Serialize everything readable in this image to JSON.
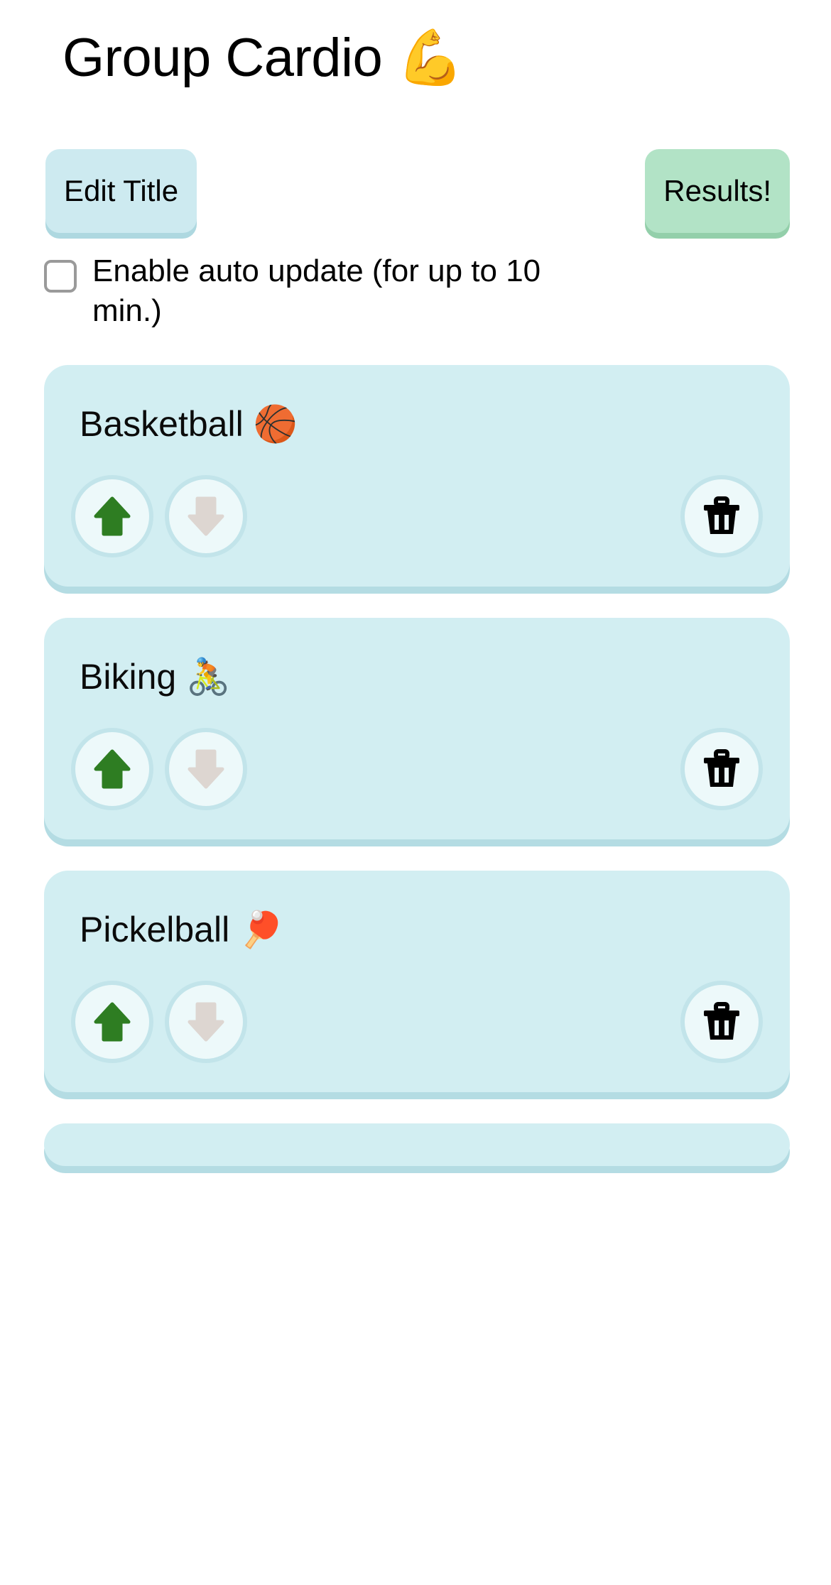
{
  "header": {
    "title": "Group Cardio 💪"
  },
  "toolbar": {
    "edit_title_label": "Edit Title",
    "results_label": "Results!"
  },
  "auto_update": {
    "label": "Enable auto update (for up to 10 min.)",
    "checked": false
  },
  "cards": [
    {
      "title": "Basketball 🏀"
    },
    {
      "title": "Biking 🚴"
    },
    {
      "title": "Pickelball 🏓"
    }
  ],
  "card_controls": {
    "move_up_icon": "arrow-up-icon",
    "move_down_icon": "arrow-down-icon",
    "delete_icon": "trash-icon"
  },
  "colors": {
    "card_bg": "#d2eef2",
    "card_shadow": "#b4dce3",
    "edit_button_bg": "#cdeaf0",
    "results_button_bg": "#b2e3c6",
    "circle_button_bg": "#edf9fa",
    "arrow_up": "#2e7d22",
    "arrow_down": "#ddd6d1",
    "trash": "#000000",
    "page_bg": "#ffffff",
    "checkbox_border": "#9a9a9a"
  }
}
